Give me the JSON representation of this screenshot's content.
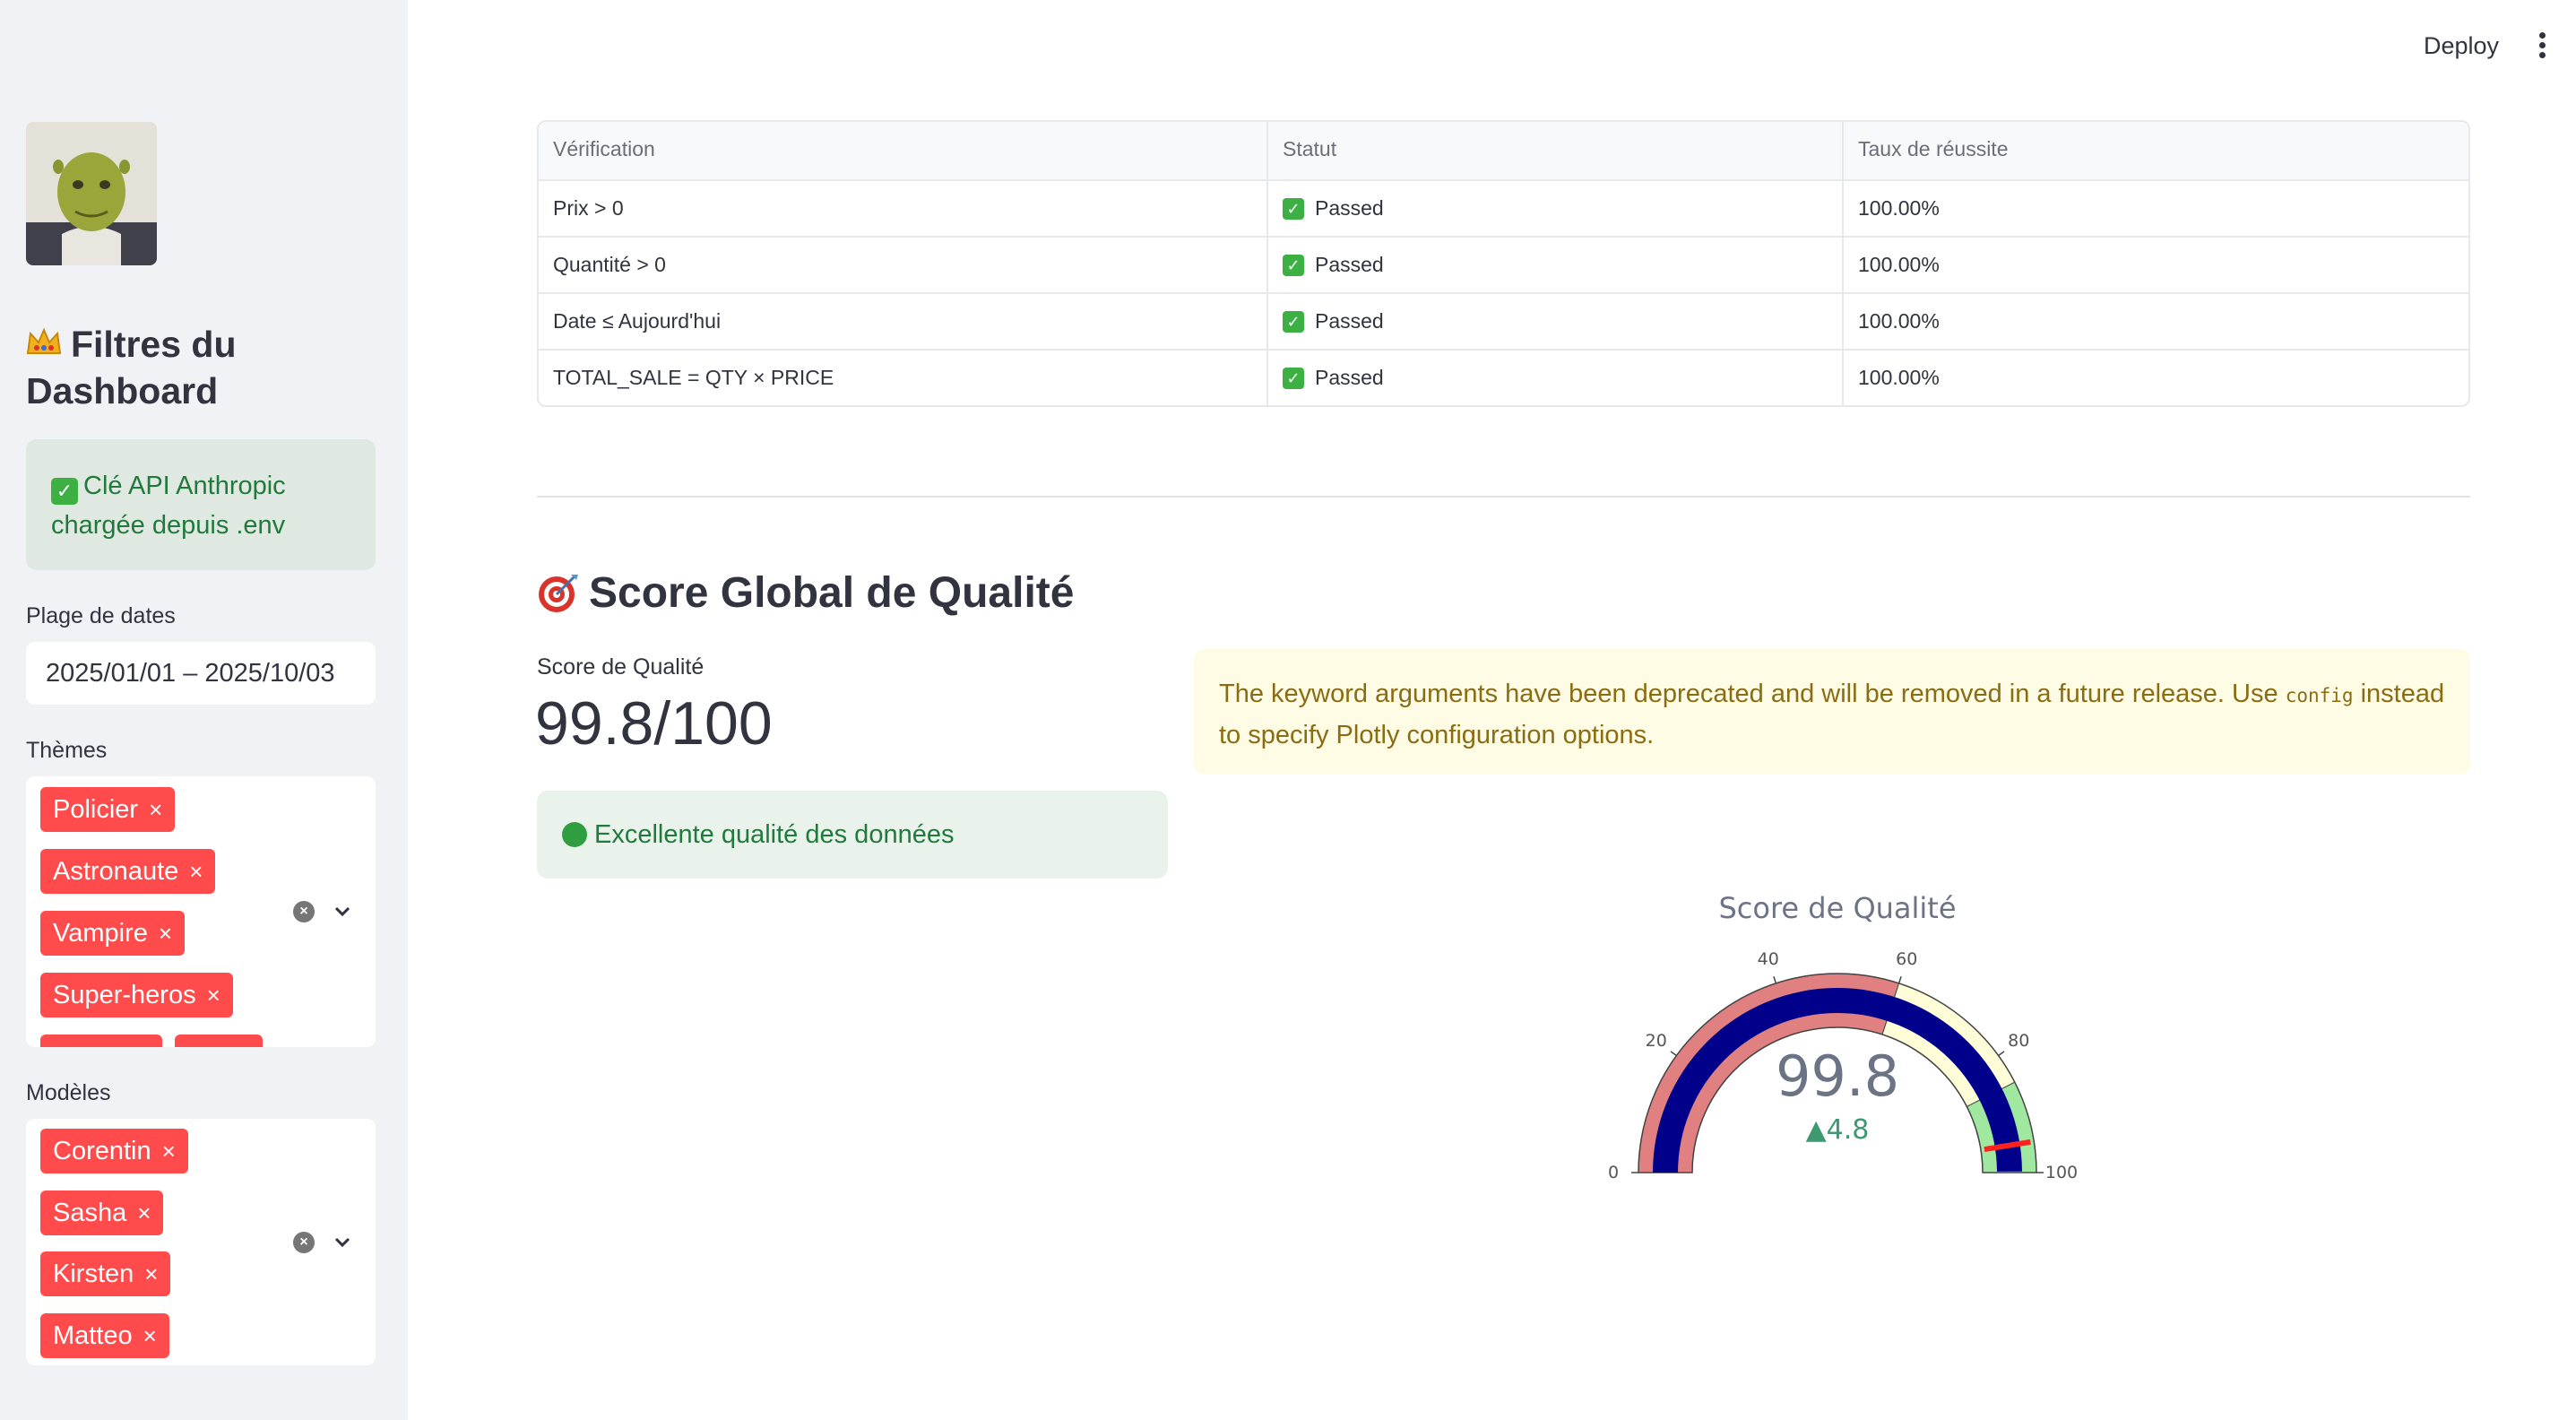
{
  "header": {
    "deploy_label": "Deploy",
    "menu_icon": "kebab-menu-icon"
  },
  "sidebar": {
    "title": "Filtres du Dashboard",
    "alert_text": "Clé API Anthropic chargée depuis .env",
    "date_label": "Plage de dates",
    "date_value": "2025/01/01 – 2025/10/03",
    "themes_label": "Thèmes",
    "themes": [
      "Policier",
      "Astronaute",
      "Vampire",
      "Super-heros"
    ],
    "models_label": "Modèles",
    "models": [
      "Corentin",
      "Sasha",
      "Kirsten",
      "Matteo"
    ]
  },
  "table": {
    "headers": [
      "Vérification",
      "Statut",
      "Taux de réussite"
    ],
    "rows": [
      {
        "check": "Prix > 0",
        "status": "Passed",
        "rate": "100.00%"
      },
      {
        "check": "Quantité > 0",
        "status": "Passed",
        "rate": "100.00%"
      },
      {
        "check": "Date ≤ Aujourd'hui",
        "status": "Passed",
        "rate": "100.00%"
      },
      {
        "check": "TOTAL_SALE = QTY × PRICE",
        "status": "Passed",
        "rate": "100.00%"
      }
    ]
  },
  "section_title": "Score Global de Qualité",
  "metric": {
    "label": "Score de Qualité",
    "value": "99.8/100"
  },
  "success_msg": "Excellente qualité des données",
  "warning": {
    "before": "The keyword arguments have been deprecated and will be removed in a future release. Use ",
    "code": "config",
    "after": " instead to specify Plotly configuration options."
  },
  "gauge": {
    "title": "Score de Qualité",
    "value": 99.8,
    "value_label": "99.8",
    "delta_label": "▲4.8",
    "range": [
      0,
      100
    ],
    "tick_labels": [
      "0",
      "20",
      "40",
      "60",
      "80",
      "100"
    ],
    "steps": [
      {
        "from": 0,
        "to": 60,
        "color": "#e08080"
      },
      {
        "from": 60,
        "to": 85,
        "color": "#fffdd8"
      },
      {
        "from": 85,
        "to": 100,
        "color": "#a0e8a0"
      }
    ],
    "bar_color": "#00008b",
    "threshold": 95,
    "threshold_color": "#ff2020"
  }
}
